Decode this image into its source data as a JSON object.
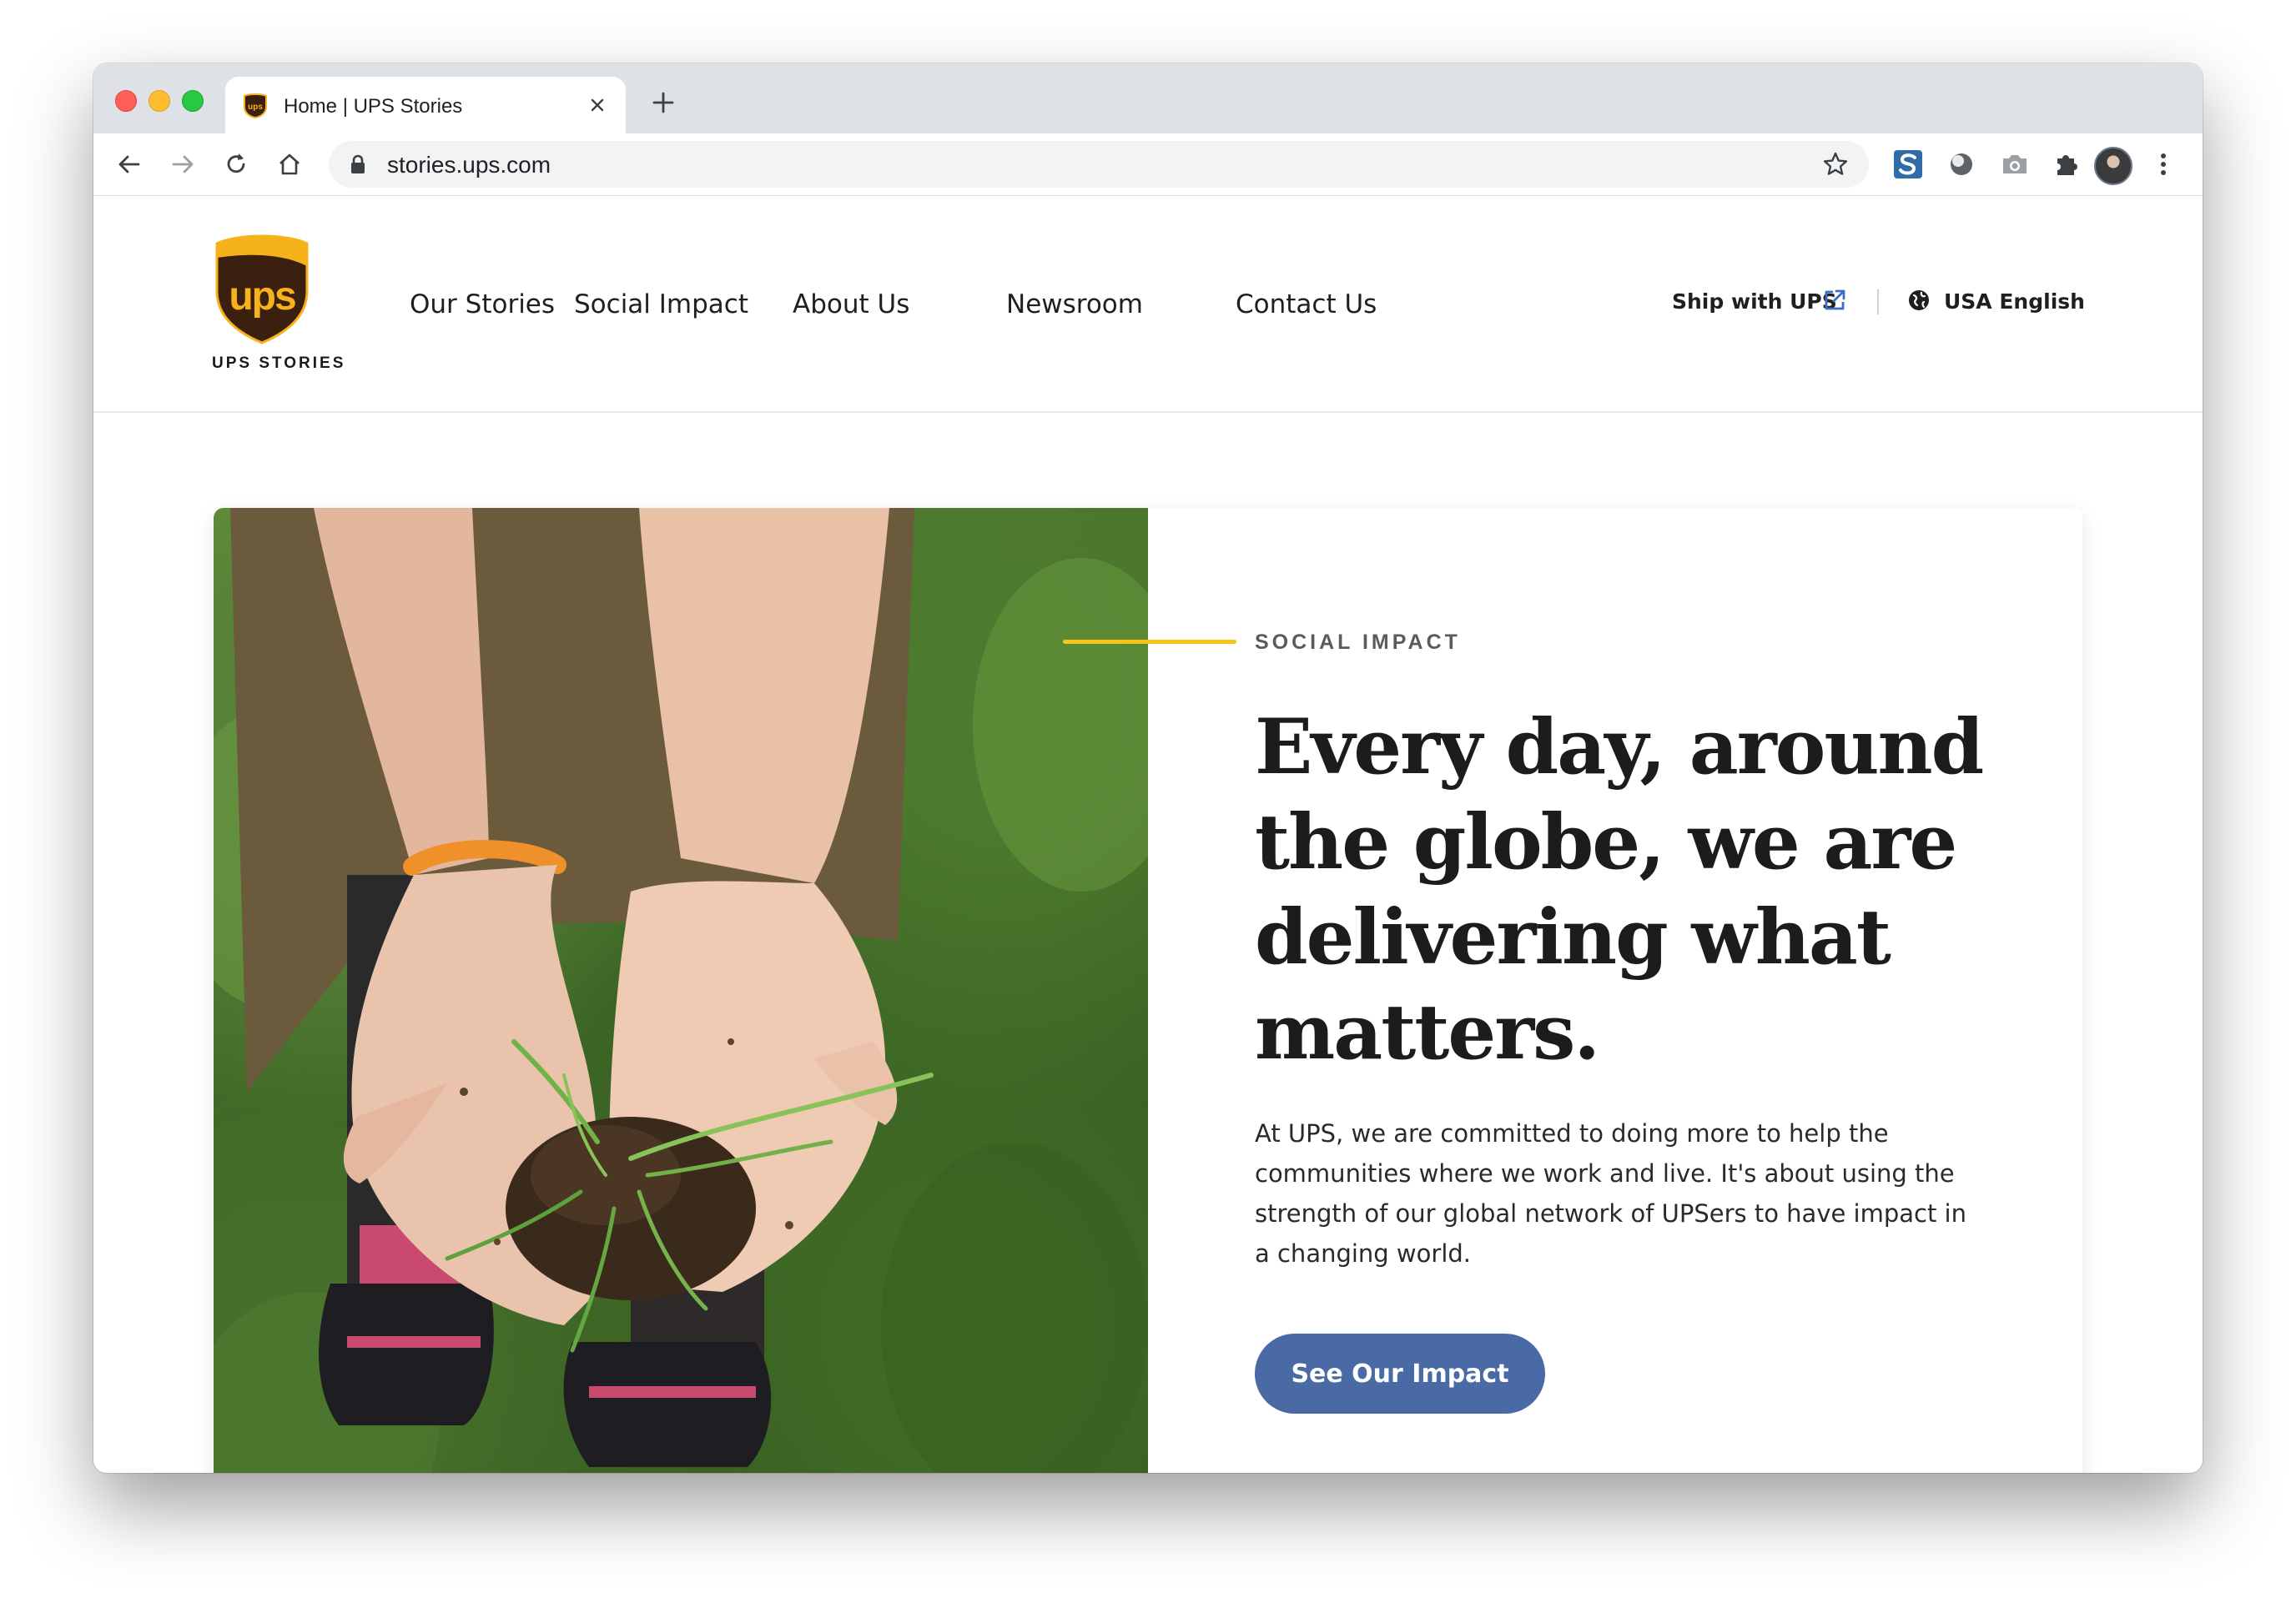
{
  "browser": {
    "tab": {
      "title": "Home | UPS Stories"
    },
    "address_bar": {
      "url": "stories.ups.com"
    },
    "icons": [
      "back-icon",
      "forward-icon",
      "reload-icon",
      "home-icon",
      "lock-icon",
      "star-icon",
      "extension-icon",
      "profile-avatar"
    ]
  },
  "site": {
    "logo_text": "UPS STORIES",
    "logo_mark": "ups",
    "nav": [
      "Our Stories",
      "Social Impact",
      "About Us",
      "Newsroom",
      "Contact Us"
    ],
    "utility": {
      "ship_label": "Ship with UPS",
      "language_label": "USA English"
    }
  },
  "hero": {
    "eyebrow": "SOCIAL IMPACT",
    "headline": "Every day, around the globe, we are delivering what matters.",
    "body": "At UPS, we are committed to doing more to help the communities where we work and live. It's about using the strength of our global network of UPSers to have impact in a changing world.",
    "cta_label": "See Our Impact",
    "image_subject": "cupped hands holding soil and grass sprouts"
  },
  "colors": {
    "accent_yellow": "#f5c518",
    "cta_blue": "#4a6aa5",
    "ups_brown": "#3b1f0f",
    "ups_gold": "#f5b21a"
  }
}
